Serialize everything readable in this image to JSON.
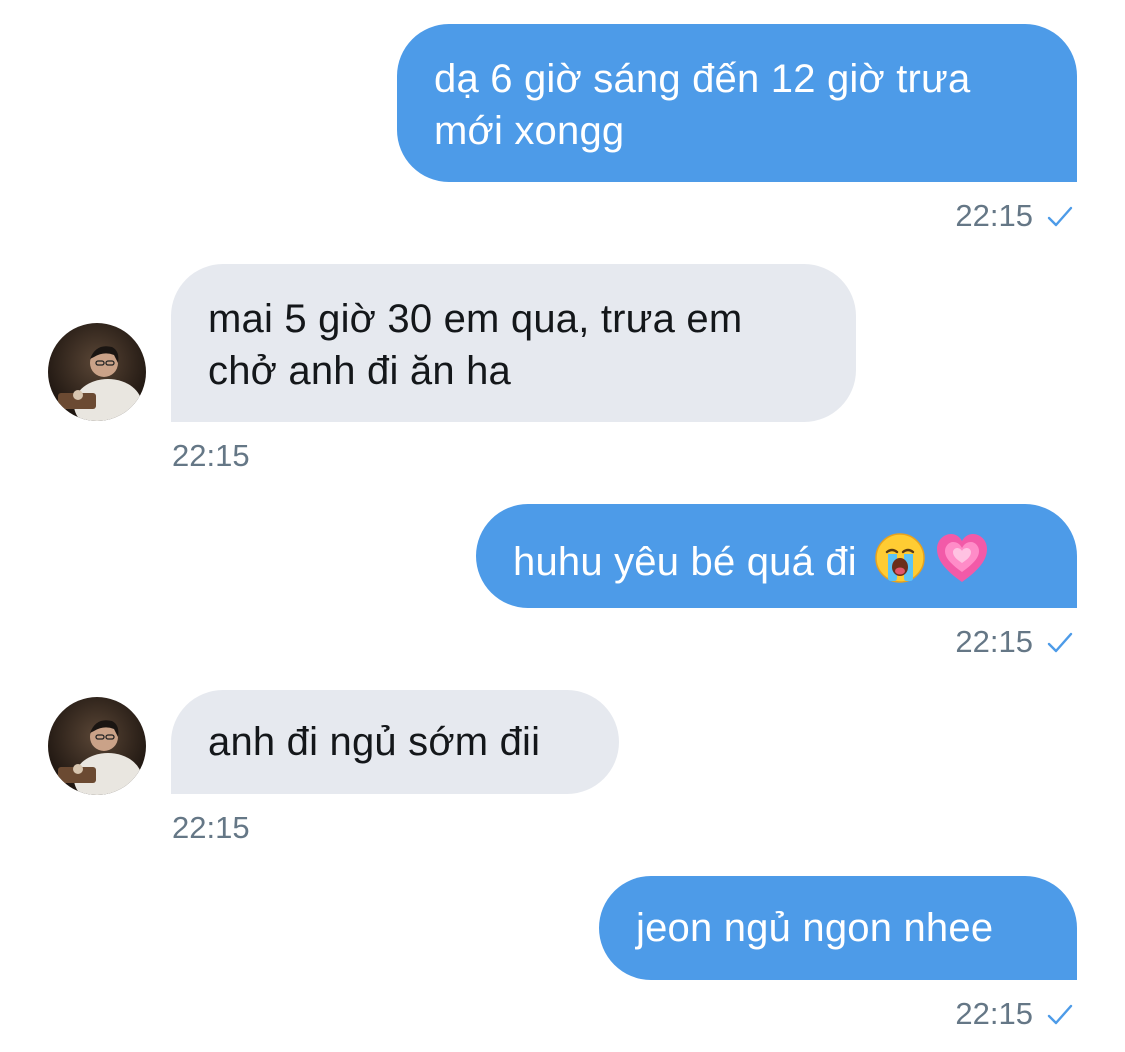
{
  "colors": {
    "sent_bubble": "#4d9be8",
    "received_bubble": "#e6e9ef",
    "timestamp": "#657786",
    "check": "#4d9be8"
  },
  "messages": [
    {
      "direction": "sent",
      "lines": [
        "dạ 6 giờ sáng đến 12 giờ trưa",
        "mới xongg"
      ],
      "time": "22:15",
      "status_icon": "check-icon"
    },
    {
      "direction": "received",
      "lines": [
        "mai 5 giờ 30 em qua, trưa em",
        "chở anh đi ăn ha"
      ],
      "time": "22:15",
      "avatar_icon": "profile-photo"
    },
    {
      "direction": "sent",
      "text": "huhu yêu bé quá đi",
      "emojis": [
        "loudly-crying-face-emoji",
        "growing-heart-emoji"
      ],
      "time": "22:15",
      "status_icon": "check-icon"
    },
    {
      "direction": "received",
      "text": "anh đi ngủ sớm đii",
      "time": "22:15",
      "avatar_icon": "profile-photo"
    },
    {
      "direction": "sent",
      "text": "jeon ngủ ngon nhee",
      "time": "22:15",
      "status_icon": "check-icon"
    }
  ]
}
